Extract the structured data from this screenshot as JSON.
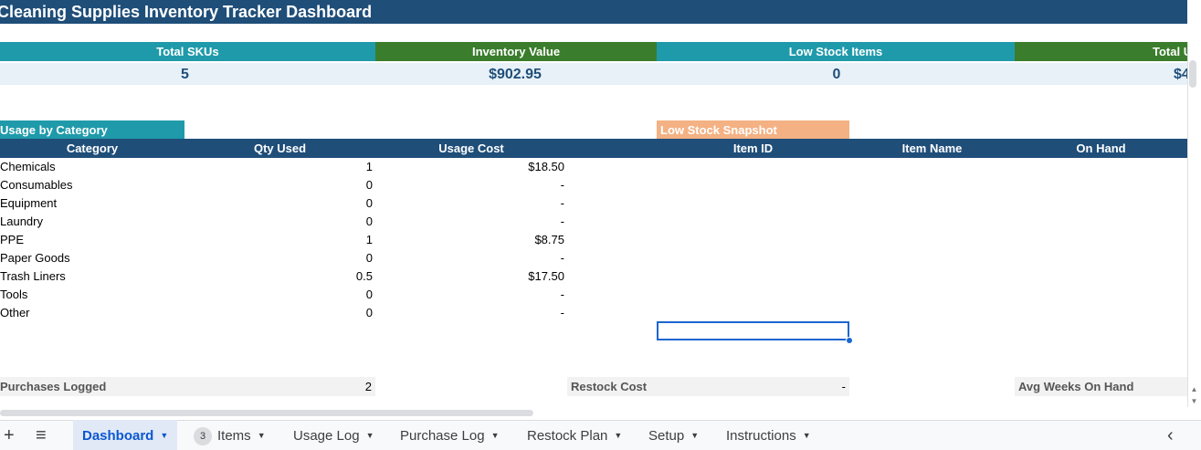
{
  "title": "Cleaning Supplies Inventory Tracker Dashboard",
  "kpis": [
    {
      "label": "Total SKUs",
      "value": "5"
    },
    {
      "label": "Inventory Value",
      "value": "$902.95"
    },
    {
      "label": "Low Stock Items",
      "value": "0"
    },
    {
      "label": "Total U",
      "value": "$4"
    }
  ],
  "usage": {
    "section_label": "Usage by Category",
    "headers": [
      "Category",
      "Qty Used",
      "Usage Cost"
    ],
    "rows": [
      {
        "category": "Chemicals",
        "qty": "1",
        "cost": "$18.50"
      },
      {
        "category": "Consumables",
        "qty": "0",
        "cost": "-"
      },
      {
        "category": "Equipment",
        "qty": "0",
        "cost": "-"
      },
      {
        "category": "Laundry",
        "qty": "0",
        "cost": "-"
      },
      {
        "category": "PPE",
        "qty": "1",
        "cost": "$8.75"
      },
      {
        "category": "Paper Goods",
        "qty": "0",
        "cost": "-"
      },
      {
        "category": "Trash Liners",
        "qty": "0.5",
        "cost": "$17.50"
      },
      {
        "category": "Tools",
        "qty": "0",
        "cost": "-"
      },
      {
        "category": "Other",
        "qty": "0",
        "cost": "-"
      }
    ]
  },
  "low_stock": {
    "section_label": "Low Stock Snapshot",
    "headers": [
      "Item ID",
      "Item Name",
      "On Hand"
    ]
  },
  "summary": {
    "purchases_label": "Purchases Logged",
    "purchases_value": "2",
    "restock_label": "Restock Cost",
    "restock_value": "-",
    "avg_label": "Avg Weeks On Hand"
  },
  "tabs": {
    "add_icon": "+",
    "menu_icon": "≡",
    "items": [
      {
        "label": "Dashboard",
        "active": true
      },
      {
        "label": "Items",
        "badge": "3"
      },
      {
        "label": "Usage Log"
      },
      {
        "label": "Purchase Log"
      },
      {
        "label": "Restock Plan"
      },
      {
        "label": "Setup"
      },
      {
        "label": "Instructions"
      }
    ],
    "scroll_left_icon": "‹"
  },
  "colors": {
    "header_navy": "#1f4e79",
    "teal": "#1f9aaa",
    "green": "#3a7d2c",
    "orange": "#f4b183",
    "selection_blue": "#1a66d2"
  }
}
